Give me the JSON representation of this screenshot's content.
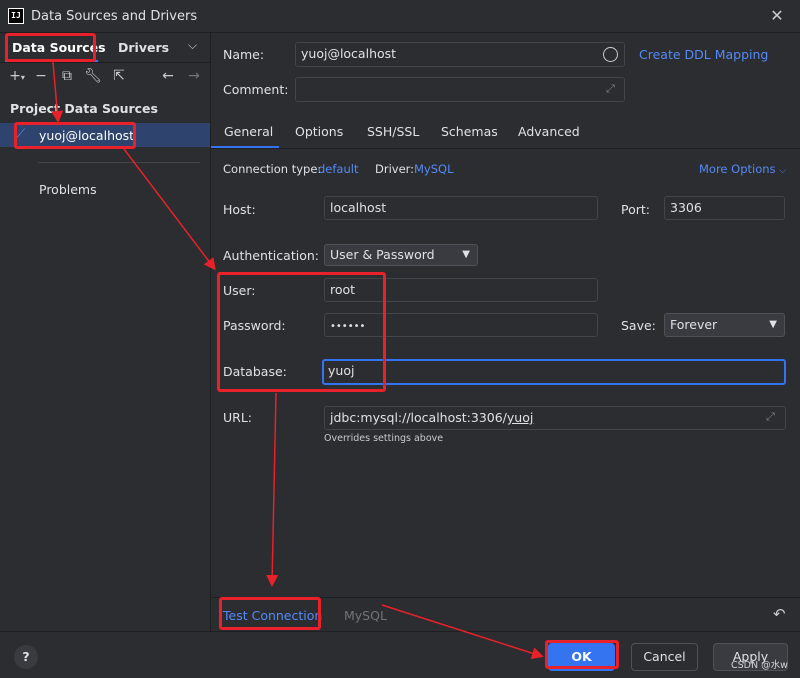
{
  "window": {
    "title": "Data Sources and Drivers",
    "app_icon_text": "IJ"
  },
  "left_panel": {
    "tabs": [
      "Data Sources",
      "Drivers"
    ],
    "section_header": "Project Data Sources",
    "selected_item": "yuoj@localhost",
    "problems": "Problems"
  },
  "form": {
    "name_label": "Name:",
    "name_value": "yuoj@localhost",
    "create_ddl": "Create DDL Mapping",
    "comment_label": "Comment:",
    "comment_value": "",
    "subtabs": [
      "General",
      "Options",
      "SSH/SSL",
      "Schemas",
      "Advanced"
    ],
    "active_subtab": "General",
    "conn_type_label": "Connection type:",
    "conn_type_value": "default",
    "driver_label": "Driver:",
    "driver_value": "MySQL",
    "more_options": "More Options",
    "host_label": "Host:",
    "host_value": "localhost",
    "port_label": "Port:",
    "port_value": "3306",
    "auth_label": "Authentication:",
    "auth_value": "User & Password",
    "user_label": "User:",
    "user_value": "root",
    "password_label": "Password:",
    "password_value": "••••••",
    "save_label": "Save:",
    "save_value": "Forever",
    "database_label": "Database:",
    "database_value": "yuoj",
    "url_label": "URL:",
    "url_prefix": "jdbc:mysql://localhost:3306/",
    "url_db": "yuoj",
    "url_hint": "Overrides settings above"
  },
  "bottom": {
    "test_connection": "Test Connection",
    "driver_link": "MySQL"
  },
  "footer": {
    "help": "?",
    "ok": "OK",
    "cancel": "Cancel",
    "apply": "Apply",
    "watermark": "CSDN @水w"
  },
  "colors": {
    "accent": "#3574f0",
    "link": "#548af7",
    "annotation": "#e8212a",
    "background": "#2b2d30",
    "selection": "#2e436e"
  }
}
